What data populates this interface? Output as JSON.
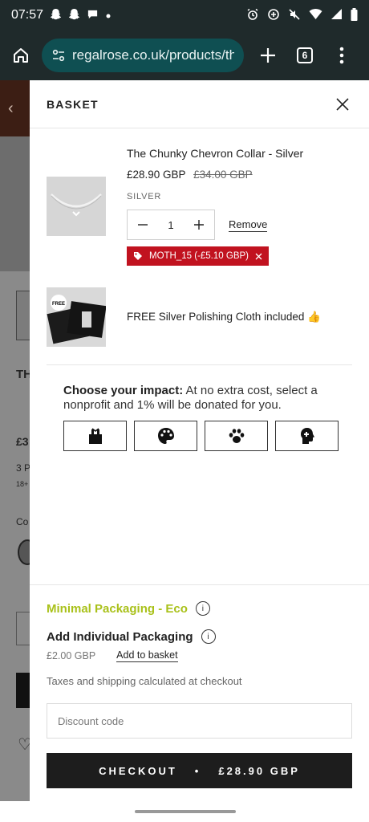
{
  "status_bar": {
    "time": "07:57",
    "icons": [
      "snapchat-icon",
      "snapchat-icon",
      "chat-icon",
      "dot-icon",
      "alarm-icon",
      "data-saver-icon",
      "mute-icon",
      "wifi-icon",
      "signal-icon",
      "battery-icon"
    ]
  },
  "browser": {
    "url": "regalrose.co.uk/products/th",
    "tab_count": "6"
  },
  "basket": {
    "title": "BASKET",
    "items": [
      {
        "name": "The Chunky Chevron Collar - Silver",
        "price": "£28.90 GBP",
        "compare_price": "£34.00 GBP",
        "variant": "SILVER",
        "quantity": "1",
        "remove_label": "Remove",
        "discount": "MOTH_15 (-£5.10 GBP)"
      }
    ],
    "gift": {
      "badge": "FREE",
      "text": "FREE Silver Polishing Cloth included 👍"
    }
  },
  "impact": {
    "heading": "Choose your impact:",
    "text": "At no extra cost, select a nonprofit and 1% will be donated for you.",
    "options": [
      "gift-icon",
      "palette-icon",
      "paw-icon",
      "mind-icon"
    ]
  },
  "packaging": {
    "eco_label": "Minimal Packaging - Eco",
    "individual_label": "Add Individual Packaging",
    "individual_price": "£2.00 GBP",
    "add_label": "Add to basket",
    "info_glyph": "i"
  },
  "checkout": {
    "tax_note": "Taxes and shipping calculated at checkout",
    "discount_placeholder": "Discount code",
    "button_label": "CHECKOUT",
    "separator": "•",
    "button_total": "£28.90 GBP"
  },
  "background_page": {
    "title_fragment": "TH",
    "price_fragment": "£3",
    "line_fragment": "3 P",
    "small_fragment": "18+",
    "label_fragment": "Co"
  },
  "colors": {
    "eco_green": "#a9c11a",
    "discount_red": "#c1121f",
    "checkout_black": "#1d1d1d",
    "browser_bar": "#1f2a2b",
    "url_pill": "#0f4f52"
  }
}
